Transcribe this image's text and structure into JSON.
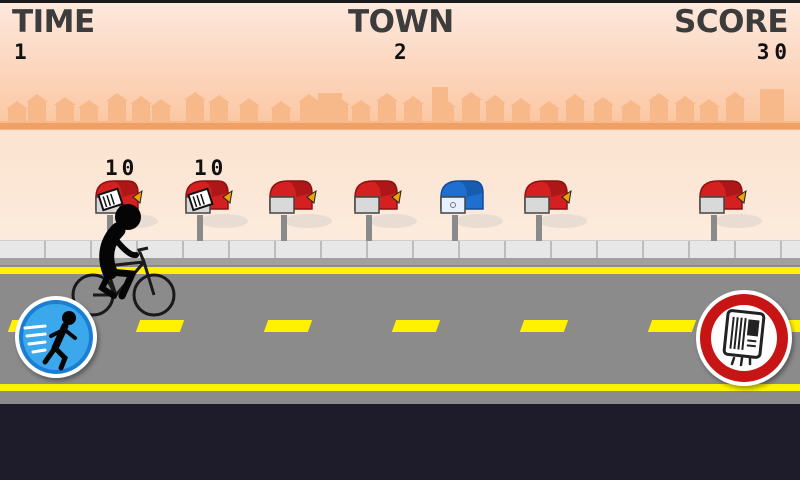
{
  "hud": {
    "time_label": "TIME",
    "time_value": "1",
    "town_label": "TOWN",
    "town_value": "2",
    "score_label": "SCORE",
    "score_value": "30"
  },
  "mailboxes": [
    {
      "color": "red",
      "flag_up": true,
      "has_mail": true,
      "points": "10"
    },
    {
      "color": "red",
      "flag_up": true,
      "has_mail": true,
      "points": "10"
    },
    {
      "color": "red",
      "flag_up": true,
      "has_mail": false,
      "points": ""
    },
    {
      "color": "red",
      "flag_up": true,
      "has_mail": false,
      "points": ""
    },
    {
      "color": "blue",
      "flag_up": false,
      "has_mail": false,
      "points": ""
    },
    {
      "color": "red",
      "flag_up": true,
      "has_mail": false,
      "points": ""
    },
    {
      "color": "red",
      "flag_up": true,
      "has_mail": false,
      "points": ""
    }
  ],
  "controls": {
    "speed_button_icon": "running-stickman-icon",
    "throw_button_icon": "newspaper-icon"
  },
  "colors": {
    "sky": "#fcd0b3",
    "skyline": "#f7b98a",
    "road": "#8b8b8b",
    "lane_yellow": "#fff200",
    "mailbox_red": "#d42020",
    "mailbox_blue": "#1f6fd0",
    "speed_button": "#2a9be0",
    "throw_button": "#d11d1d"
  }
}
